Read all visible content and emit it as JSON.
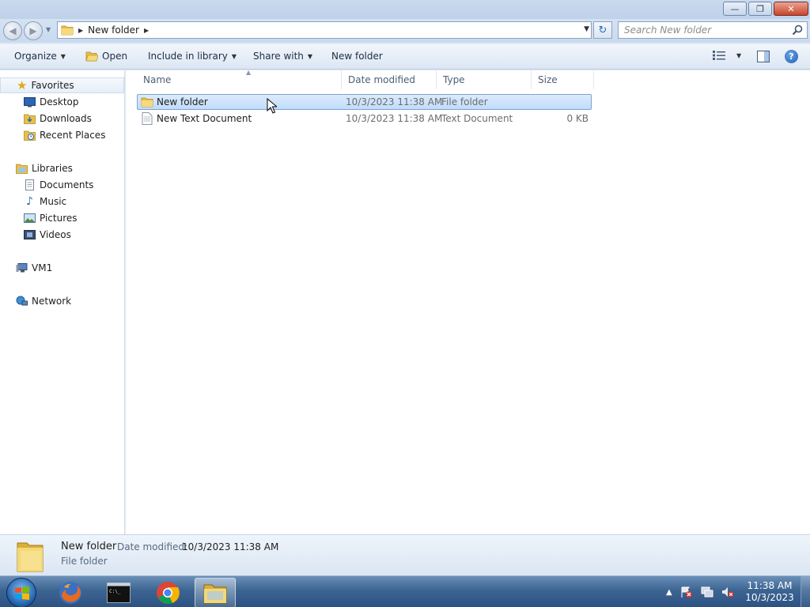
{
  "window": {
    "controls": {
      "minimize_icon": "minimize-icon",
      "restore_icon": "restore-icon",
      "close_icon": "close-icon"
    }
  },
  "address": {
    "crumbs": [
      "New folder"
    ],
    "search_placeholder": "Search New folder"
  },
  "toolbar": {
    "organize": "Organize",
    "open": "Open",
    "include_in_library": "Include in library",
    "share_with": "Share with",
    "new_folder": "New folder"
  },
  "nav": {
    "favorites": "Favorites",
    "desktop": "Desktop",
    "downloads": "Downloads",
    "recent_places": "Recent Places",
    "libraries": "Libraries",
    "documents": "Documents",
    "music": "Music",
    "pictures": "Pictures",
    "videos": "Videos",
    "computer": "VM1",
    "network": "Network"
  },
  "columns": {
    "name": "Name",
    "date_modified": "Date modified",
    "type": "Type",
    "size": "Size"
  },
  "files": [
    {
      "name": "New folder",
      "date": "10/3/2023 11:38 AM",
      "type": "File folder",
      "size": "",
      "icon": "folder-icon",
      "selected": true
    },
    {
      "name": "New Text Document",
      "date": "10/3/2023 11:38 AM",
      "type": "Text Document",
      "size": "0 KB",
      "icon": "text-document-icon",
      "selected": false
    }
  ],
  "details": {
    "name": "New folder",
    "modified_label": "Date modified:",
    "modified_value": "10/3/2023 11:38 AM",
    "type": "File folder"
  },
  "taskbar": {
    "apps": [
      "firefox-icon",
      "command-prompt-icon",
      "chrome-icon",
      "windows-explorer-icon"
    ],
    "time": "11:38 AM",
    "date": "10/3/2023"
  }
}
